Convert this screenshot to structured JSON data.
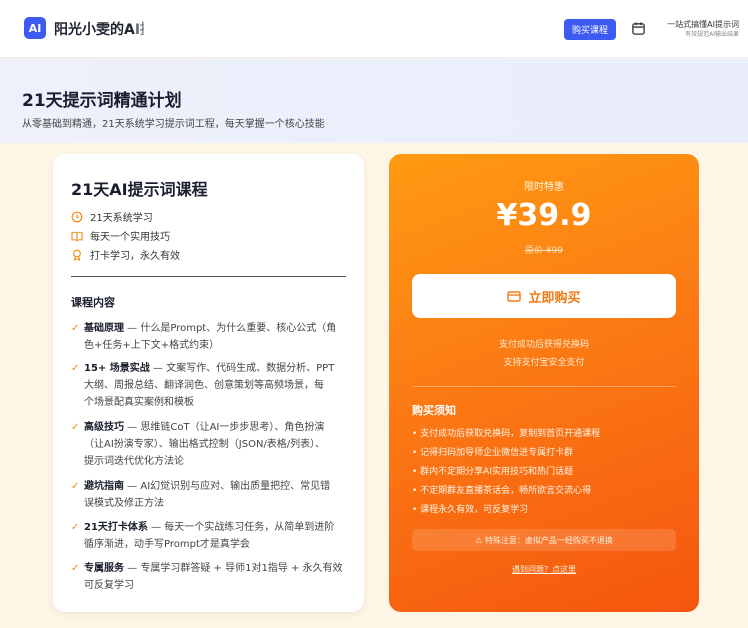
{
  "header": {
    "logo_text": "AI",
    "brand": "阳光小雯的AI提",
    "buy_button": "购买课程",
    "tagline_line1": "一站式搞懂AI提示词",
    "tagline_line2": "有效规范AI输出结果",
    "calendar_icon": "calendar-icon"
  },
  "hero": {
    "title": "21天提示词精通计划",
    "subtitle": "从零基础到精通，21天系统学习提示词工程，每天掌握一个核心技能"
  },
  "course": {
    "title": "21天AI提示词课程",
    "features": [
      {
        "icon": "clock-icon",
        "label": "21天系统学习"
      },
      {
        "icon": "book-icon",
        "label": "每天一个实用技巧"
      },
      {
        "icon": "award-icon",
        "label": "打卡学习，永久有效"
      }
    ],
    "section_title": "课程内容",
    "items": [
      {
        "head": "基础原理",
        "line1": " — 什么是Prompt、为什么重要、核心公式（角",
        "line2": "色+任务+上下文+格式约束）",
        "line3": ""
      },
      {
        "head": "15+ 场景实战",
        "line1": " — 文案写作、代码生成、数据分析、PPT",
        "line2": "大纲、周报总结、翻译润色、创意策划等高频场景，每",
        "line3": "个场景配真实案例和模板"
      },
      {
        "head": "高级技巧",
        "line1": " — 思维链CoT（让AI一步步思考）、角色扮演",
        "line2": "（让AI扮演专家）、输出格式控制（JSON/表格/列表）、",
        "line3": "提示词迭代优化方法论"
      },
      {
        "head": "避坑指南",
        "line1": " — AI幻觉识别与应对、输出质量把控、常见错",
        "line2": "误模式及修正方法",
        "line3": ""
      },
      {
        "head": "21天打卡体系",
        "line1": " — 每天一个实战练习任务，从简单到进阶",
        "line2": "循序渐进，动手写Prompt才是真学会",
        "line3": ""
      },
      {
        "head": "专属服务",
        "line1": " — 专属学习群答疑 + 导师1对1指导 + 永久有效",
        "line2": "可反复学习",
        "line3": ""
      }
    ]
  },
  "pricing": {
    "limited": "限时特惠",
    "price": "¥39.9",
    "original": "原价 ¥99",
    "buy_now": "立即购买",
    "pay_note1": "支付成功后获得兑换码",
    "pay_note2": "支持支付宝安全支付",
    "notice_title": "购买须知",
    "notices": [
      "• 支付成功后获取兑换码，复制到首页开通课程",
      "• 记得扫码加导师企业微信进专属打卡群",
      "• 群内不定期分享AI实用技巧和热门话题",
      "• 不定期群友直播茶话会，畅所欲言交流心得",
      "• 课程永久有效，可反复学习"
    ],
    "warning": "⚠ 特殊注意：虚拟产品一经购买不退换",
    "help_link": "遇到问题？点这里"
  }
}
